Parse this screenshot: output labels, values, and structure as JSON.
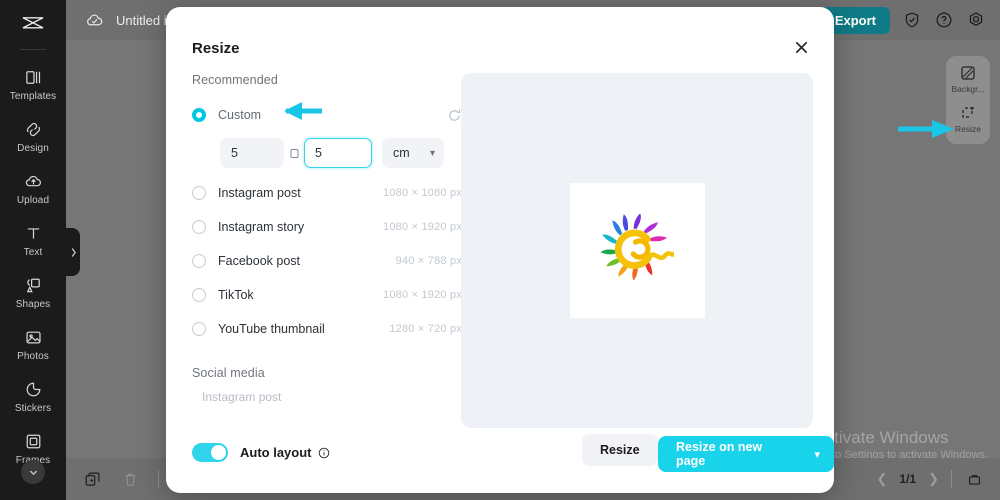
{
  "app": {
    "topbar": {
      "cloud_icon": "cloud-check-icon",
      "title": "Untitled i",
      "export_label": "Export",
      "icons": [
        "shield-check-icon",
        "help-circle-icon",
        "settings-gear-icon"
      ]
    },
    "sidebar": {
      "logo": "app-logo-icon",
      "items": [
        {
          "label": "Templates",
          "icon": "templates-icon"
        },
        {
          "label": "Design",
          "icon": "design-icon"
        },
        {
          "label": "Upload",
          "icon": "upload-cloud-icon"
        },
        {
          "label": "Text",
          "icon": "text-icon"
        },
        {
          "label": "Shapes",
          "icon": "shapes-icon"
        },
        {
          "label": "Photos",
          "icon": "photos-icon"
        },
        {
          "label": "Stickers",
          "icon": "stickers-icon"
        },
        {
          "label": "Frames",
          "icon": "frames-icon"
        }
      ],
      "more_icon": "chevron-down-icon",
      "collapse_icon": "chevron-right-icon"
    },
    "right_panel": {
      "items": [
        {
          "label": "Backgr...",
          "icon": "background-icon"
        },
        {
          "label": "Resize",
          "icon": "resize-icon"
        }
      ]
    },
    "bottombar": {
      "icons": [
        "duplicate-page-icon",
        "delete-page-icon",
        "add-page-icon"
      ],
      "prev_icon": "chevron-left-icon",
      "next_icon": "chevron-right-icon",
      "page_counter": "1/1",
      "grid_icon": "pages-grid-icon"
    },
    "watermark": {
      "line1": "Activate Windows",
      "line2": "Go to Settings to activate Windows."
    }
  },
  "modal": {
    "title": "Resize",
    "close_icon": "close-x-icon",
    "recommended": {
      "heading": "Recommended",
      "custom": {
        "label": "Custom",
        "selected": true,
        "reset_icon": "reset-circle-icon",
        "width_value": "5",
        "height_value": "5",
        "link_icon": "link-aspect-icon",
        "unit_value": "cm",
        "unit_caret_icon": "chevron-down-icon"
      },
      "presets": [
        {
          "label": "Instagram post",
          "dimensions": "1080 × 1080 px",
          "selected": false
        },
        {
          "label": "Instagram story",
          "dimensions": "1080 × 1920 px",
          "selected": false
        },
        {
          "label": "Facebook post",
          "dimensions": "940 × 788 px",
          "selected": false
        },
        {
          "label": "TikTok",
          "dimensions": "1080 × 1920 px",
          "selected": false
        },
        {
          "label": "YouTube thumbnail",
          "dimensions": "1280 × 720 px",
          "selected": false
        }
      ]
    },
    "social_media": {
      "heading": "Social media",
      "items": [
        {
          "label": "Instagram post"
        }
      ]
    },
    "auto_layout": {
      "label": "Auto layout",
      "enabled": true,
      "info_icon": "info-circle-icon"
    },
    "preview": {
      "artwork": "rainbow-sun-logo"
    },
    "footer": {
      "secondary_label": "Resize",
      "primary_label": "Resize on new page",
      "primary_caret_icon": "chevron-down-icon"
    }
  },
  "annotations": {
    "arrow_color": "#19c6e6",
    "arrows": [
      {
        "target": "custom-option"
      },
      {
        "target": "right-panel-resize"
      }
    ]
  },
  "colors": {
    "accent": "#19d3ea",
    "accent_alt": "#2fd4ea",
    "export_green": "#0f7b86",
    "rail_bg": "#1b1b1b",
    "preview_bg": "#eef1f5",
    "field_bg": "#f1f3f6"
  }
}
